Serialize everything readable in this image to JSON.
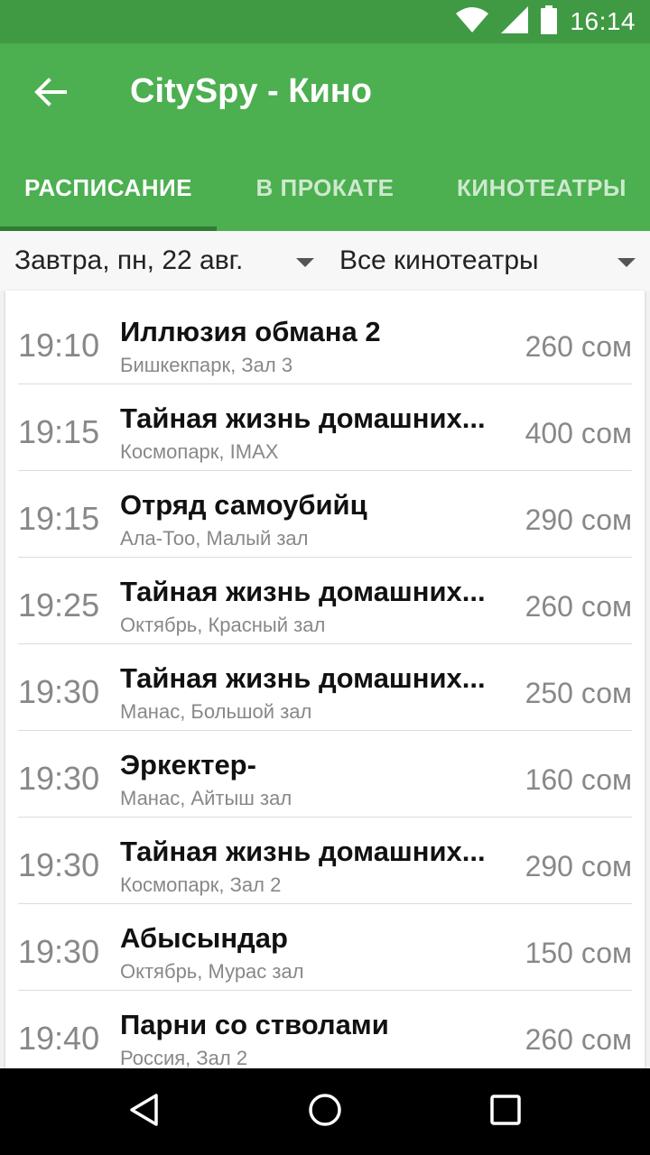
{
  "status_bar": {
    "time": "16:14"
  },
  "app_bar": {
    "title": "CitySpy - Кино"
  },
  "tabs": [
    {
      "label": "РАСПИСАНИЕ",
      "active": true
    },
    {
      "label": "В ПРОКАТЕ",
      "active": false
    },
    {
      "label": "КИНОТЕАТРЫ",
      "active": false
    }
  ],
  "filters": {
    "date": "Завтра, пн, 22 авг.",
    "cinema": "Все кинотеатры"
  },
  "showtimes": [
    {
      "time": "19:10",
      "title": "Иллюзия обмана 2",
      "venue": "Бишкекпарк, Зал 3",
      "price": "260 сом"
    },
    {
      "time": "19:15",
      "title": "Тайная жизнь домашних...",
      "venue": "Космопарк, IMAX",
      "price": "400 сом"
    },
    {
      "time": "19:15",
      "title": "Отряд самоубийц",
      "venue": "Ала-Тоо, Малый зал",
      "price": "290 сом"
    },
    {
      "time": "19:25",
      "title": "Тайная жизнь домашних...",
      "venue": "Октябрь, Красный зал",
      "price": "260 сом"
    },
    {
      "time": "19:30",
      "title": "Тайная жизнь домашних...",
      "venue": "Манас, Большой зал",
      "price": "250 сом"
    },
    {
      "time": "19:30",
      "title": "Эркектер-",
      "venue": "Манас, Айтыш зал",
      "price": "160 сом"
    },
    {
      "time": "19:30",
      "title": "Тайная жизнь домашних...",
      "venue": "Космопарк, Зал 2",
      "price": "290 сом"
    },
    {
      "time": "19:30",
      "title": "Абысындар",
      "venue": "Октябрь, Мурас зал",
      "price": "150 сом"
    },
    {
      "time": "19:40",
      "title": "Парни со стволами",
      "venue": "Россия, Зал 2",
      "price": "260 сом"
    }
  ],
  "icons": {
    "wifi": "wifi-icon",
    "signal": "signal-icon",
    "battery": "battery-icon",
    "back": "arrow-left-icon",
    "dropdown": "caret-down-icon",
    "nav_back": "triangle-back-icon",
    "nav_home": "circle-home-icon",
    "nav_recents": "square-recents-icon"
  },
  "colors": {
    "status_bar": "#3f9a43",
    "app_bar": "#4caf50",
    "tab_indicator": "#2e7d32"
  }
}
